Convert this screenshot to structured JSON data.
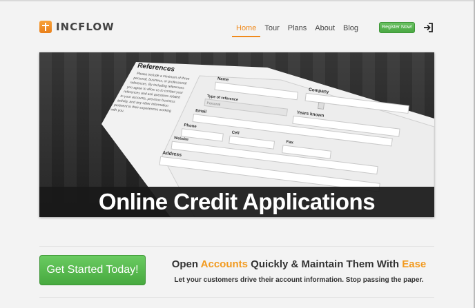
{
  "header": {
    "logo_text": "INCFLOW",
    "nav": [
      {
        "label": "Home",
        "active": true
      },
      {
        "label": "Tour",
        "active": false
      },
      {
        "label": "Plans",
        "active": false
      },
      {
        "label": "About",
        "active": false
      },
      {
        "label": "Blog",
        "active": false
      }
    ],
    "register_label": "Register Now!",
    "login_icon": "sign-in-icon"
  },
  "hero": {
    "caption": "Online Credit Applications",
    "form_title": "References",
    "form_intro": "Please include a minimum of three personal, business, or professional references. By including references you agree to allow us to contact your references and ask questions related to your accounts, previous business activity, and any other information pertinent to their experiences working with you.",
    "form_labels": {
      "name": "Name",
      "company": "Company",
      "type": "Type of reference",
      "type_value": "Personal",
      "years": "Years known",
      "email": "Email",
      "phone": "Phone",
      "cell": "Cell",
      "fax": "Fax",
      "website": "Website",
      "address": "Address"
    }
  },
  "cta": {
    "button_label": "Get Started Today!",
    "tagline_open": "Open ",
    "tagline_accounts": "Accounts",
    "tagline_mid": " Quickly & Maintain Them With ",
    "tagline_ease": "Ease",
    "subline": "Let your customers drive their account information. Stop passing the paper."
  },
  "colors": {
    "accent": "#f08a1c",
    "green": "#4aa843",
    "hero_dark": "#1f1f1f"
  }
}
